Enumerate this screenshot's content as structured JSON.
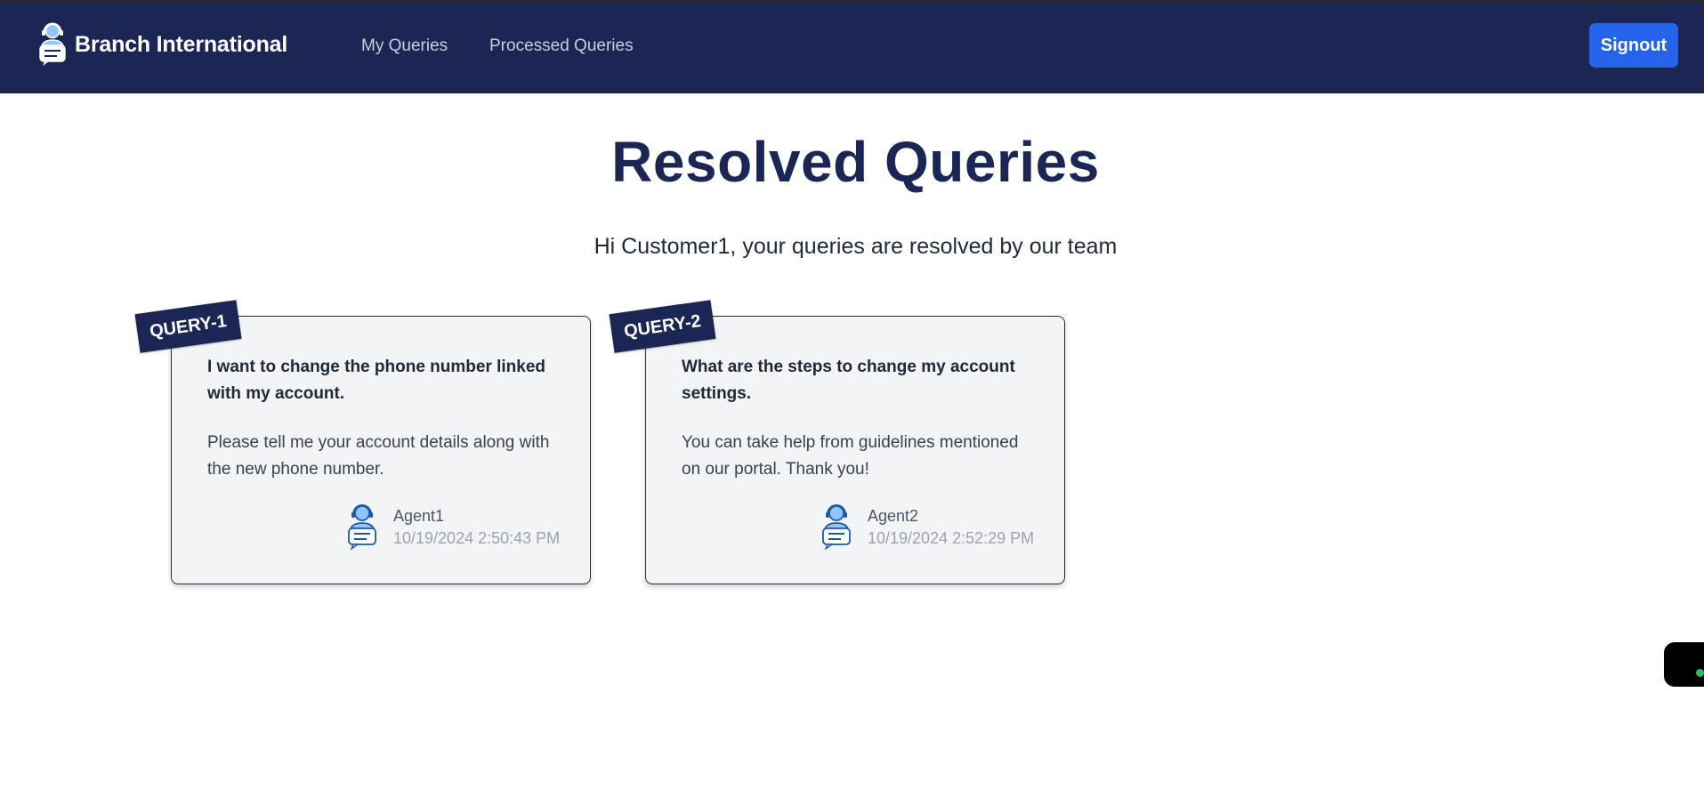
{
  "header": {
    "brand_name": "Branch International",
    "brand_icon": "support-agent-icon",
    "nav": [
      {
        "label": "My Queries"
      },
      {
        "label": "Processed Queries"
      }
    ],
    "signout_label": "Signout",
    "background_color": "#1b2654",
    "signout_color": "#2563eb"
  },
  "main": {
    "title": "Resolved Queries",
    "subtitle": "Hi Customer1, your queries are resolved by our team"
  },
  "queries": [
    {
      "tag": "QUERY-1",
      "question": "I want to change the phone number linked with my account.",
      "answer": "Please tell me your account details along with the new phone number.",
      "agent": "Agent1",
      "timestamp": "10/19/2024 2:50:43 PM"
    },
    {
      "tag": "QUERY-2",
      "question": "What are the steps to change my account settings.",
      "answer": "You can take help from guidelines mentioned on our portal. Thank you!",
      "agent": "Agent2",
      "timestamp": "10/19/2024 2:52:29 PM"
    }
  ],
  "colors": {
    "accent": "#1b2654",
    "card_background": "#f3f4f6",
    "status_online": "#22c55e"
  }
}
